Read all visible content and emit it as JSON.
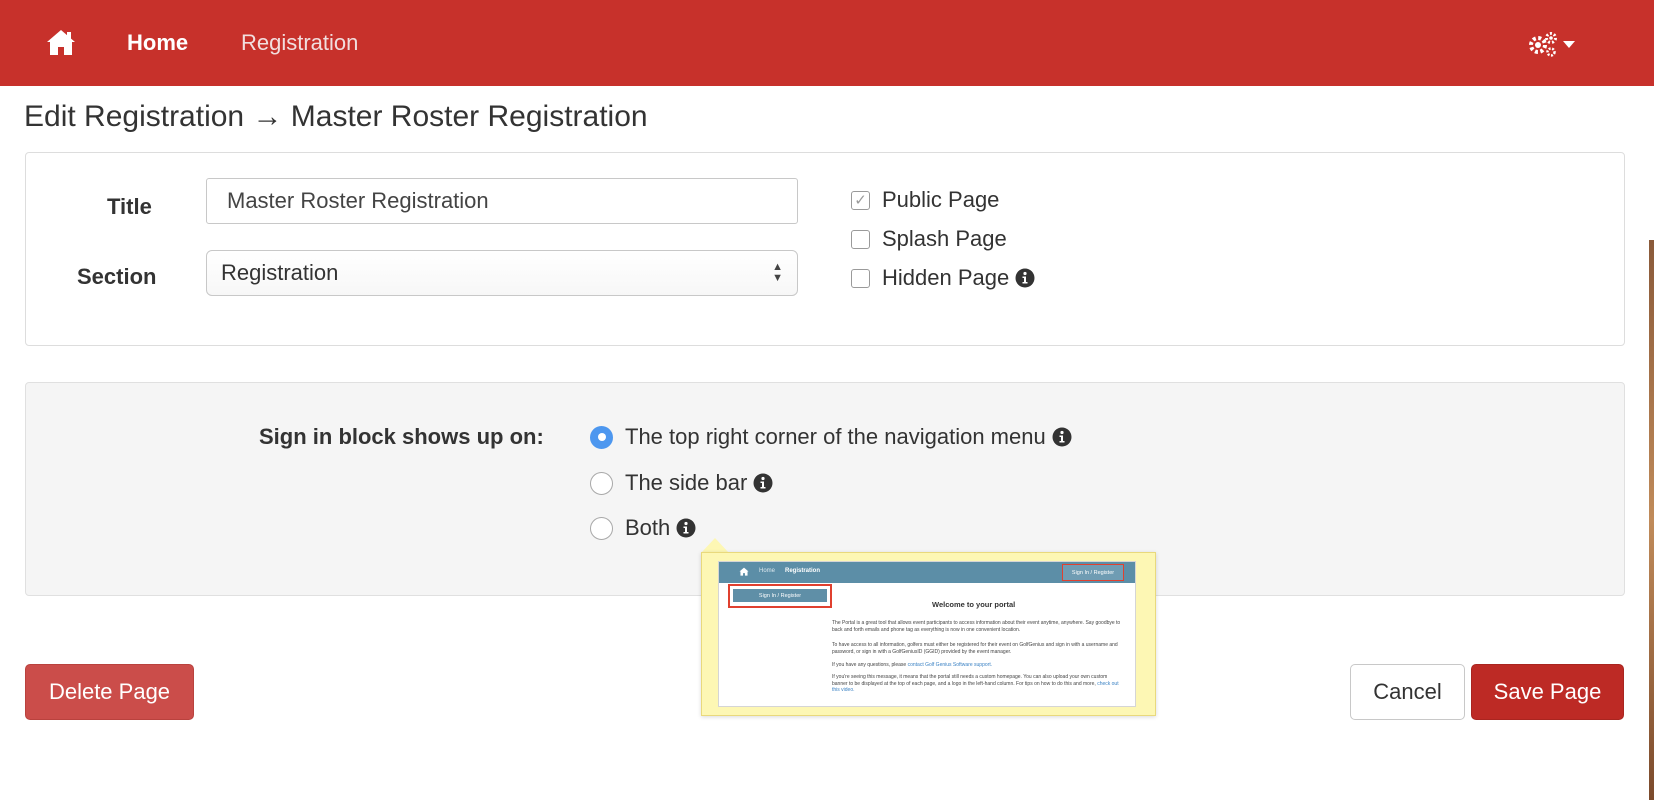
{
  "navbar": {
    "brand_color": "#c7312b",
    "home_icon": "home-icon",
    "links": [
      {
        "label": "Home"
      },
      {
        "label": "Registration"
      }
    ],
    "settings_icon": "gears-icon",
    "settings_caret_icon": "caret-down-icon"
  },
  "page": {
    "title": "Edit Registration → Master Roster Registration"
  },
  "form": {
    "title_label": "Title",
    "title_value": "Master Roster Registration",
    "section_label": "Section",
    "section_value": "Registration",
    "checkboxes": [
      {
        "label": "Public Page",
        "checked": true
      },
      {
        "label": "Splash Page",
        "checked": false
      },
      {
        "label": "Hidden Page",
        "checked": false
      }
    ]
  },
  "signin": {
    "label": "Sign in block shows up on:",
    "options": [
      {
        "label": "The top right corner of the navigation menu",
        "selected": true
      },
      {
        "label": "The side bar",
        "selected": false
      },
      {
        "label": "Both",
        "selected": false
      }
    ]
  },
  "tooltip_preview": {
    "nav_links": [
      "Home",
      "Registration"
    ],
    "signin_top": "Sign In / Register",
    "signin_side": "Sign In / Register",
    "welcome": "Welcome to your portal",
    "paragraphs": [
      "The Portal is a great tool that allows event participants to access information about their event anytime, anywhere. Say goodbye to back and forth emails and phone tag as everything is now in one convenient location.",
      "To have access to all information, golfers must either be registered for their event on GolfGenius and sign in with a username and password, or sign in with a GolfGeniusID (GGID) provided by the event manager.",
      "If you have any questions, please",
      "contact Golf Genius Software support.",
      "If you're seeing this message, it means that the portal still needs a custom homepage. You can also upload your own custom banner to be displayed at the top of each page, and a logo in the left-hand column. For tips on how to do this and more,",
      "check out this video."
    ]
  },
  "buttons": {
    "delete": "Delete Page",
    "cancel": "Cancel",
    "save": "Save Page"
  },
  "colors": {
    "radio_selected": "#4d97ef",
    "delete_button": "#cb4d4a",
    "save_button": "#bd2a25",
    "tooltip_bg": "#fdf7b4"
  }
}
